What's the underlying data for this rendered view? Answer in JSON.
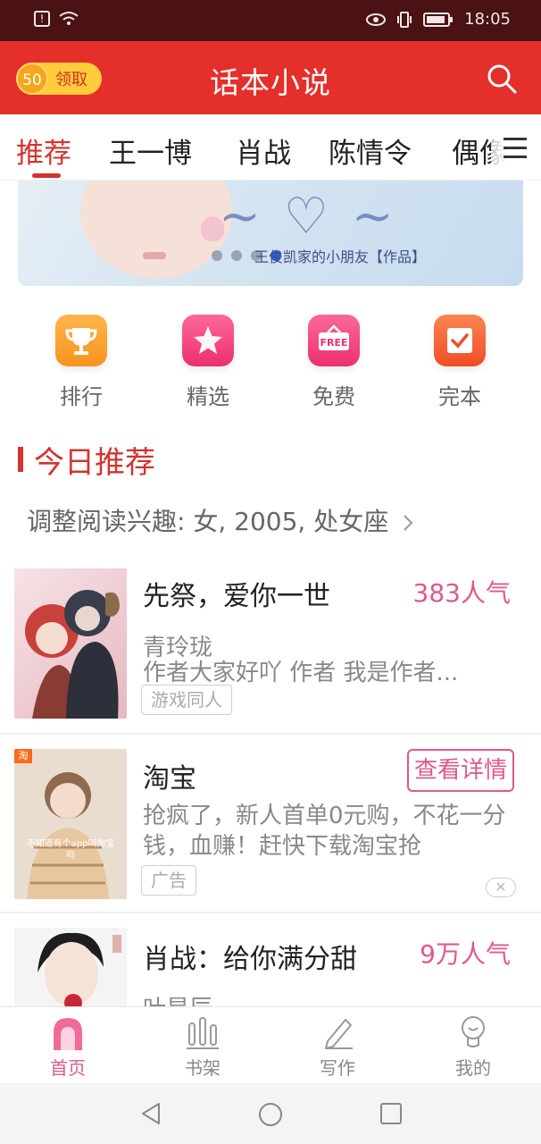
{
  "status_bar": {
    "time": "18:05"
  },
  "app_bar": {
    "reward_coins": "50",
    "reward_label": "领取",
    "title": "话本小说"
  },
  "tabs": [
    "推荐",
    "王一博",
    "肖战",
    "陈情令",
    "偶像"
  ],
  "banner": {
    "credit": "王俊凯家的小朋友【作品】",
    "active_index": 3
  },
  "shortcuts": [
    {
      "label": "排行",
      "icon": "trophy-icon",
      "color": "#f8a21f"
    },
    {
      "label": "精选",
      "icon": "star-icon",
      "color": "#f0447a"
    },
    {
      "label": "免费",
      "icon": "free-icon",
      "color": "#f0447a"
    },
    {
      "label": "完本",
      "icon": "check-icon",
      "color": "#f26132"
    }
  ],
  "section": {
    "title": "今日推荐",
    "interest": "调整阅读兴趣: 女, 2005, 处女座"
  },
  "books": [
    {
      "title": "先祭，爱你一世",
      "popularity": "383人气",
      "author": "青玲珑",
      "desc": "作者大家好吖 作者 我是作者...",
      "tag": "游戏同人"
    },
    {
      "title": "淘宝",
      "cta": "查看详情",
      "desc": "抢疯了，新人首单0元购，不花一分钱，血赚！赶快下载淘宝抢",
      "tag": "广告",
      "badge": "淘",
      "cover_caption": "不知道有个app叫淘宝吗",
      "close": "✕"
    },
    {
      "title": "肖战：给你满分甜",
      "popularity": "9万人气",
      "author": "叶星辰"
    }
  ],
  "bottom_nav": [
    {
      "label": "首页",
      "icon": "home-icon",
      "active": true
    },
    {
      "label": "书架",
      "icon": "bookshelf-icon",
      "active": false
    },
    {
      "label": "写作",
      "icon": "pen-icon",
      "active": false
    },
    {
      "label": "我的",
      "icon": "profile-icon",
      "active": false
    }
  ],
  "colors": {
    "brand": "#e52f2a",
    "accent": "#d4332e",
    "pink": "#e0588c"
  }
}
